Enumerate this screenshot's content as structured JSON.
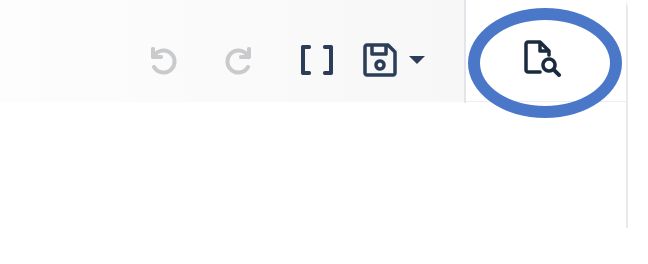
{
  "toolbar": {
    "buttons": [
      {
        "name": "undo",
        "icon": "undo-icon",
        "enabled": false
      },
      {
        "name": "redo",
        "icon": "redo-icon",
        "enabled": false
      },
      {
        "name": "brackets",
        "icon": "brackets-icon",
        "enabled": true
      },
      {
        "name": "save",
        "icon": "save-icon",
        "enabled": true,
        "has_dropdown": true
      }
    ]
  },
  "side_panel": {
    "button": {
      "name": "document-search",
      "icon": "document-search-icon",
      "enabled": true
    }
  },
  "annotation": {
    "highlight": "document-search-button",
    "color": "#4b77c9"
  },
  "colors": {
    "icon_active": "#2c3e57",
    "icon_disabled": "#c8cacc",
    "panel_icon": "#1b2b3f"
  }
}
